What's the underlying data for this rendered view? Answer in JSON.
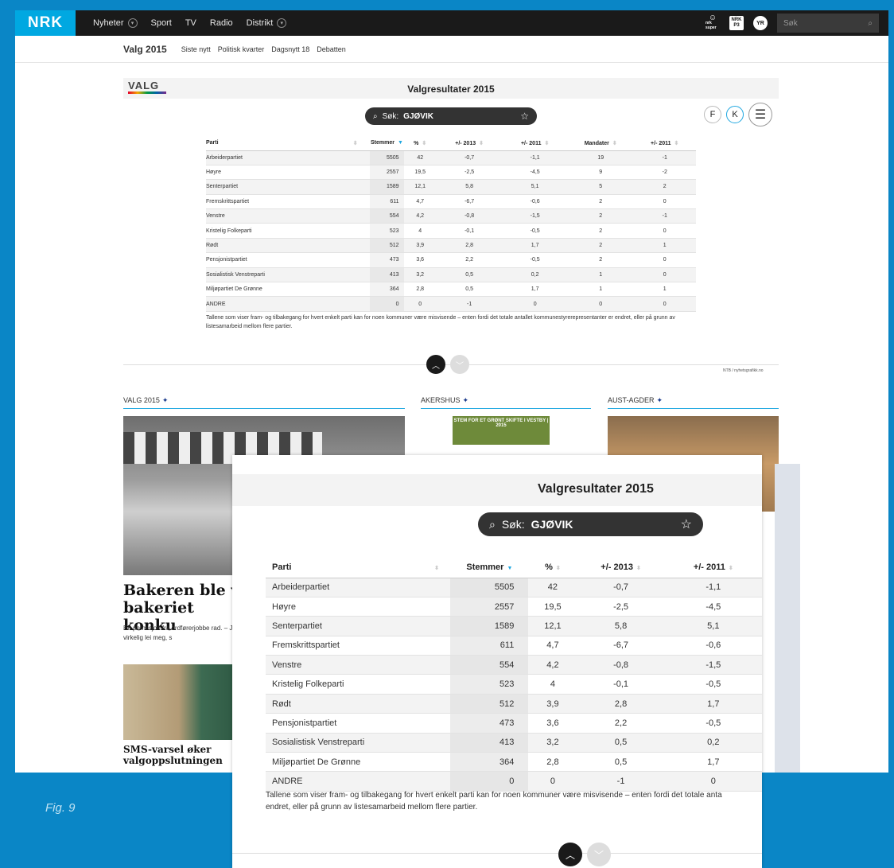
{
  "topbar": {
    "logo": "NRK",
    "nav": [
      "Nyheter",
      "Sport",
      "TV",
      "Radio",
      "Distrikt"
    ],
    "search_placeholder": "Søk",
    "icons": [
      "nrk-super-icon",
      "p3-icon",
      "yr-icon"
    ],
    "icon_labels": {
      "super": "nrk super",
      "p3": "NRK P3",
      "yr": "YR"
    }
  },
  "subnav": {
    "title": "Valg 2015",
    "items": [
      "Siste nytt",
      "Politisk kvarter",
      "Dagsnytt 18",
      "Debatten"
    ]
  },
  "widget": {
    "logo": "VALG",
    "title": "Valgresultater 2015",
    "controls": [
      "F",
      "K",
      "☰"
    ],
    "search_label": "Søk:",
    "search_value": "GJØVIK",
    "columns": [
      "Parti",
      "Stemmer",
      "%",
      "+/- 2013",
      "+/- 2011",
      "Mandater",
      "+/- 2011"
    ],
    "rows": [
      [
        "Arbeiderpartiet",
        "5505",
        "42",
        "-0,7",
        "-1,1",
        "19",
        "-1"
      ],
      [
        "Høyre",
        "2557",
        "19,5",
        "-2,5",
        "-4,5",
        "9",
        "-2"
      ],
      [
        "Senterpartiet",
        "1589",
        "12,1",
        "5,8",
        "5,1",
        "5",
        "2"
      ],
      [
        "Fremskrittspartiet",
        "611",
        "4,7",
        "-6,7",
        "-0,6",
        "2",
        "0"
      ],
      [
        "Venstre",
        "554",
        "4,2",
        "-0,8",
        "-1,5",
        "2",
        "-1"
      ],
      [
        "Kristelig Folkeparti",
        "523",
        "4",
        "-0,1",
        "-0,5",
        "2",
        "0"
      ],
      [
        "Rødt",
        "512",
        "3,9",
        "2,8",
        "1,7",
        "2",
        "1"
      ],
      [
        "Pensjonistpartiet",
        "473",
        "3,6",
        "2,2",
        "-0,5",
        "2",
        "0"
      ],
      [
        "Sosialistisk Venstreparti",
        "413",
        "3,2",
        "0,5",
        "0,2",
        "1",
        "0"
      ],
      [
        "Miljøpartiet De Grønne",
        "364",
        "2,8",
        "0,5",
        "1,7",
        "1",
        "1"
      ],
      [
        "ANDRE",
        "0",
        "0",
        "-1",
        "0",
        "0",
        "0"
      ]
    ],
    "note": "Tallene som viser fram- og tilbakegang for hvert enkelt parti kan for noen kommuner være misvisende – enten fordi det totale antallet kommunestyrerepresentanter er endret, eller på grunn av listesamarbeid mellom flere partier.",
    "credit": "NTB / nyhetsgrafikk.no"
  },
  "sections": [
    {
      "label": "VALG 2015"
    },
    {
      "label": "AKERSHUS"
    },
    {
      "label": "AUST-AGDER"
    }
  ],
  "poster_text": "STEM FOR ET GRØNT SKIFTE I VESTBY | 2015",
  "articles": {
    "main_headline": "Bakeren ble va bakeriet konku",
    "main_lede": "En permisjon fra ordførerjobbe rad. – Jeg er virkelig lei meg, s",
    "second_headline": "SMS-varsel øker valgoppslutningen"
  },
  "zoom": {
    "title": "Valgresultater 2015",
    "search_label": "Søk:",
    "search_value": "GJØVIK",
    "columns": [
      "Parti",
      "Stemmer",
      "%",
      "+/- 2013",
      "+/- 2011"
    ],
    "note_line1": "Tallene som viser fram- og tilbakegang for hvert enkelt parti kan for noen kommuner være misvisende – enten fordi det totale anta",
    "note_line2": "endret, eller på grunn av listesamarbeid mellom flere partier."
  },
  "figure_label": "Fig. 9"
}
